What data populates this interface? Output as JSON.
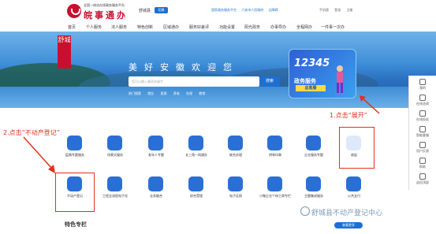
{
  "header": {
    "brand_sub": "全国一体化在线政务服务平台",
    "brand_title": "皖事通办",
    "city": "舒城县",
    "switch_label": "切换",
    "top_links": [
      "国家政务服务平台",
      "六安市人民政府",
      "无障碍"
    ],
    "top_right": [
      "手机版",
      "登录",
      "注册"
    ]
  },
  "nav": {
    "items": [
      "首页",
      "个人服务",
      "法人服务",
      "特色创新",
      "区域通办",
      "服务好差评",
      "功能设置",
      "阳光政务",
      "办事导办",
      "全程网办",
      "一件事一次办"
    ]
  },
  "hero": {
    "stamp": "舒城",
    "slogan": "美好安徽欢迎您",
    "search_placeholder": "您可以输入事项关键字",
    "search_button": "搜索",
    "hot_label": "热门搜索",
    "hot_items": [
      "就业",
      "医保",
      "养老",
      "社保",
      "教育"
    ],
    "banner_number": "12345",
    "banner_line1": "政务服务",
    "banner_line2": "总客服"
  },
  "right_sidebar": {
    "items": [
      "我的",
      "在线咨询",
      "在线投诉",
      "智能客服",
      "用户反馈",
      "帮助",
      "返回顶部"
    ]
  },
  "annotations": {
    "step1": "1.点击“展开”",
    "step2": "2.点击“不动产登记”"
  },
  "services": {
    "row1": [
      "疫情专题服务",
      "场景式服务",
      "老年人专题",
      "长三角一网通办",
      "联合办理",
      "明琴印章",
      "企业服务专题",
      "收起"
    ],
    "row2": [
      "不动产登记",
      "工程全流程电子化",
      "业务融合",
      "综合受理",
      "电子证照",
      "小微企业个体工商专栏",
      "主题集成服务",
      "公共支付"
    ]
  },
  "section_title": "特色专栏",
  "more_button": "查看更多",
  "watermark": "舒城县不动产登记中心",
  "colors": {
    "brand_red": "#c8102e",
    "primary_blue": "#1f6fd1",
    "annotation_red": "#e0301e"
  }
}
